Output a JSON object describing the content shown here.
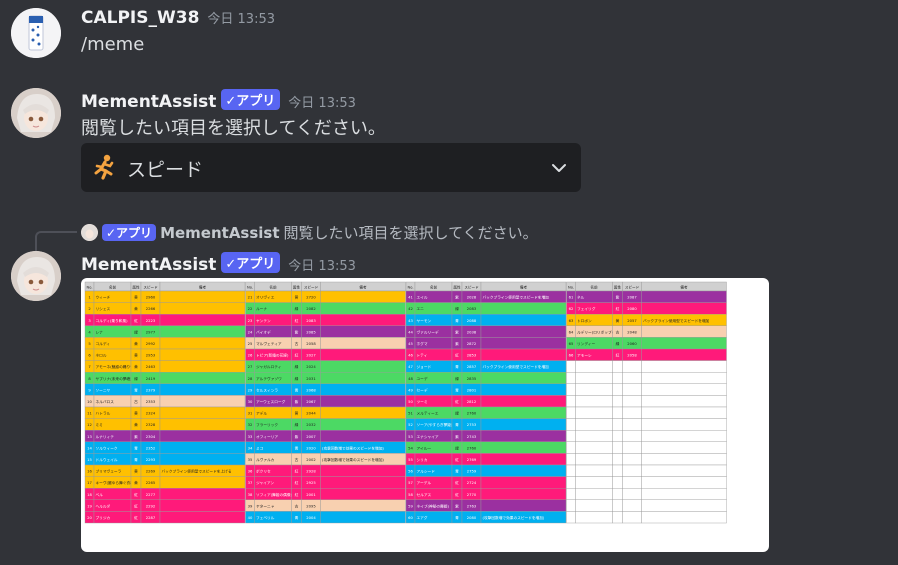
{
  "messages": [
    {
      "username": "CALPIS_W38",
      "time": "今日 13:53",
      "text": "/meme",
      "avatar_icon": "calpis-bottle-avatar"
    },
    {
      "username": "MementAssist",
      "badge": "✓アプリ",
      "time": "今日 13:53",
      "text": "閲覧したい項目を選択してください。",
      "avatar_icon": "anime-character-avatar",
      "select": {
        "emoji": "runner-emoji",
        "value": "スピード",
        "icon": "chevron-down-icon"
      }
    },
    {
      "reply": {
        "badge": "✓アプリ",
        "username": "MementAssist",
        "text": "閲覧したい項目を選択してください。"
      },
      "username": "MementAssist",
      "badge": "✓アプリ",
      "time": "今日 13:53",
      "attachment": "speed-table-image"
    }
  ],
  "table": {
    "header": [
      "No.",
      "名前",
      "属性",
      "スピード",
      "備考"
    ],
    "colors": {
      "yellow": "#ffc000",
      "green": "#4cd964",
      "red": "#ff1a7a",
      "purple": "#9b30a0",
      "blue": "#00b0f0",
      "peach": "#f8d0b0",
      "header": "#d0d0d0"
    },
    "columns": [
      {
        "rows": [
          {
            "no": "1",
            "name": "ウィーチ",
            "attr": "黄",
            "speed": "2960",
            "note": "",
            "color": "yellow"
          },
          {
            "no": "2",
            "name": "リシェス",
            "attr": "黄",
            "speed": "2266",
            "note": "",
            "color": "yellow"
          },
          {
            "no": "3",
            "name": "コルディ(乗り和風)",
            "attr": "紅",
            "speed": "2223",
            "note": "",
            "color": "red"
          },
          {
            "no": "4",
            "name": "レナ",
            "attr": "緑",
            "speed": "2977",
            "note": "",
            "color": "green"
          },
          {
            "no": "5",
            "name": "コルディ",
            "attr": "黄",
            "speed": "2992",
            "note": "",
            "color": "yellow"
          },
          {
            "no": "6",
            "name": "ネロル",
            "attr": "黄",
            "speed": "2953",
            "note": "",
            "color": "yellow"
          },
          {
            "no": "7",
            "name": "アモーネ(魅惑の踊り子)",
            "attr": "黄",
            "speed": "2463",
            "note": "",
            "color": "yellow"
          },
          {
            "no": "8",
            "name": "サブリナ(未来の夢峰)",
            "attr": "緑",
            "speed": "2419",
            "note": "",
            "color": "green"
          },
          {
            "no": "9",
            "name": "ソーニヤ",
            "attr": "青",
            "speed": "2379",
            "note": "",
            "color": "blue"
          },
          {
            "no": "10",
            "name": "ネルバロス",
            "attr": "古",
            "speed": "2353",
            "note": "",
            "color": "peach"
          },
          {
            "no": "11",
            "name": "ハトラル",
            "attr": "黄",
            "speed": "2324",
            "note": "",
            "color": "yellow"
          },
          {
            "no": "12",
            "name": "ミミ",
            "attr": "黄",
            "speed": "2328",
            "note": "",
            "color": "yellow"
          },
          {
            "no": "13",
            "name": "ルナリィテ",
            "attr": "紫",
            "speed": "2304",
            "note": "",
            "color": "purple"
          },
          {
            "no": "14",
            "name": "ソルウィーク",
            "attr": "青",
            "speed": "2352",
            "note": "",
            "color": "blue"
          },
          {
            "no": "15",
            "name": "ドルウェイル",
            "attr": "青",
            "speed": "2293",
            "note": "",
            "color": "blue"
          },
          {
            "no": "16",
            "name": "ブリマヴェーラ",
            "attr": "黄",
            "speed": "2269",
            "note": "バックプライン使用型でスピードを上げる",
            "color": "yellow"
          },
          {
            "no": "17",
            "name": "キーヴ(麗ゆら舞ぐ衣装)",
            "attr": "黄",
            "speed": "2265",
            "note": "",
            "color": "yellow"
          },
          {
            "no": "18",
            "name": "ベル",
            "attr": "紅",
            "speed": "2277",
            "note": "",
            "color": "red"
          },
          {
            "no": "19",
            "name": "ヘルルダ",
            "attr": "紅",
            "speed": "2292",
            "note": "",
            "color": "red"
          },
          {
            "no": "20",
            "name": "ブリジカ",
            "attr": "紅",
            "speed": "2287",
            "note": "",
            "color": "red"
          }
        ]
      },
      {
        "rows": [
          {
            "no": "21",
            "name": "オリヴィエ",
            "attr": "黄",
            "speed": "2720",
            "note": "",
            "color": "yellow"
          },
          {
            "no": "22",
            "name": "ルーナ",
            "attr": "緑",
            "speed": "2082",
            "note": "",
            "color": "green"
          },
          {
            "no": "23",
            "name": "ヤンテン",
            "attr": "紅",
            "speed": "2083",
            "note": "",
            "color": "red"
          },
          {
            "no": "24",
            "name": "バイオデ",
            "attr": "紫",
            "speed": "2085",
            "note": "",
            "color": "purple"
          },
          {
            "no": "25",
            "name": "マルヴェティア",
            "attr": "古",
            "speed": "2058",
            "note": "",
            "color": "peach"
          },
          {
            "no": "26",
            "name": "トピア(新婚の花嫁)",
            "attr": "紅",
            "speed": "2027",
            "note": "",
            "color": "red"
          },
          {
            "no": "27",
            "name": "ジャガルロティ",
            "attr": "緑",
            "speed": "2024",
            "note": "",
            "color": "green"
          },
          {
            "no": "28",
            "name": "アルテヴァゾワ",
            "attr": "緑",
            "speed": "2031",
            "note": "",
            "color": "green"
          },
          {
            "no": "29",
            "name": "セルスィンラ",
            "attr": "青",
            "speed": "2068",
            "note": "",
            "color": "blue"
          },
          {
            "no": "30",
            "name": "アーウェスローグ",
            "attr": "紫",
            "speed": "2067",
            "note": "",
            "color": "purple"
          },
          {
            "no": "31",
            "name": "アデル",
            "attr": "黄",
            "speed": "2044",
            "note": "",
            "color": "yellow"
          },
          {
            "no": "32",
            "name": "フラーリック",
            "attr": "緑",
            "speed": "2032",
            "note": "",
            "color": "green"
          },
          {
            "no": "33",
            "name": "オフィーリア",
            "attr": "紫",
            "speed": "2007",
            "note": "",
            "color": "purple"
          },
          {
            "no": "34",
            "name": "ミコ",
            "attr": "青",
            "speed": "2020",
            "note": "(攻撃回数増で効果のスピードを増加)",
            "color": "blue"
          },
          {
            "no": "35",
            "name": "ルヴァルカ",
            "attr": "古",
            "speed": "2002",
            "note": "(攻撃回数増で効果のスピードを増加)",
            "color": "peach"
          },
          {
            "no": "36",
            "name": "ボクリセ",
            "attr": "紅",
            "speed": "2928",
            "note": "",
            "color": "red"
          },
          {
            "no": "37",
            "name": "ジャイアン",
            "attr": "紅",
            "speed": "2925",
            "note": "",
            "color": "red"
          },
          {
            "no": "38",
            "name": "ソフィア(舞姫の偶像)",
            "attr": "紅",
            "speed": "2001",
            "note": "",
            "color": "red"
          },
          {
            "no": "39",
            "name": "ヤターニャ",
            "attr": "古",
            "speed": "2095",
            "note": "",
            "color": "peach"
          },
          {
            "no": "40",
            "name": "フェベリル",
            "attr": "青",
            "speed": "2004",
            "note": "",
            "color": "blue"
          }
        ]
      },
      {
        "rows": [
          {
            "no": "41",
            "name": "エイル",
            "attr": "紫",
            "speed": "2028",
            "note": "バックプライン使用型でスピードを増加",
            "color": "purple"
          },
          {
            "no": "42",
            "name": "エニ",
            "attr": "緑",
            "speed": "2083",
            "note": "",
            "color": "green"
          },
          {
            "no": "43",
            "name": "ヤーモン",
            "attr": "青",
            "speed": "2088",
            "note": "",
            "color": "blue"
          },
          {
            "no": "44",
            "name": "ヴァルリーデ",
            "attr": "紫",
            "speed": "2038",
            "note": "",
            "color": "purple"
          },
          {
            "no": "45",
            "name": "ホグマ",
            "attr": "紫",
            "speed": "2872",
            "note": "",
            "color": "purple"
          },
          {
            "no": "46",
            "name": "トティ",
            "attr": "紅",
            "speed": "2853",
            "note": "",
            "color": "red"
          },
          {
            "no": "47",
            "name": "ジョード",
            "attr": "青",
            "speed": "2857",
            "note": "バックプライン使用型でスピードを増加",
            "color": "blue"
          },
          {
            "no": "48",
            "name": "ユーデ",
            "attr": "緑",
            "speed": "2835",
            "note": "",
            "color": "green"
          },
          {
            "no": "49",
            "name": "セーデ",
            "attr": "青",
            "speed": "2801",
            "note": "",
            "color": "blue"
          },
          {
            "no": "50",
            "name": "ツーミ",
            "attr": "紅",
            "speed": "2812",
            "note": "",
            "color": "red"
          },
          {
            "no": "51",
            "name": "メルティーエ",
            "attr": "緑",
            "speed": "2760",
            "note": "",
            "color": "green"
          },
          {
            "no": "52",
            "name": "ソーア(やすらぎ夢姫)",
            "attr": "青",
            "speed": "2753",
            "note": "",
            "color": "blue"
          },
          {
            "no": "53",
            "name": "エナシャイア",
            "attr": "紫",
            "speed": "2743",
            "note": "",
            "color": "purple"
          },
          {
            "no": "54",
            "name": "アイル一",
            "attr": "緑",
            "speed": "2760",
            "note": "",
            "color": "green"
          },
          {
            "no": "55",
            "name": "シリカ",
            "attr": "紅",
            "speed": "2769",
            "note": "",
            "color": "red"
          },
          {
            "no": "56",
            "name": "アルシード",
            "attr": "青",
            "speed": "2759",
            "note": "",
            "color": "blue"
          },
          {
            "no": "57",
            "name": "アーデル",
            "attr": "紅",
            "speed": "2724",
            "note": "",
            "color": "red"
          },
          {
            "no": "58",
            "name": "セルアス",
            "attr": "紅",
            "speed": "2770",
            "note": "",
            "color": "red"
          },
          {
            "no": "59",
            "name": "ネイブ(神秘の舞姫)",
            "attr": "紫",
            "speed": "2763",
            "note": "",
            "color": "purple"
          },
          {
            "no": "60",
            "name": "エアグ",
            "attr": "青",
            "speed": "2080",
            "note": "(攻撃回数増で効果のスピードを増加)",
            "color": "blue"
          }
        ]
      },
      {
        "rows": [
          {
            "no": "61",
            "name": "ネル",
            "attr": "紫",
            "speed": "2087",
            "note": "",
            "color": "purple"
          },
          {
            "no": "62",
            "name": "フェイリグ",
            "attr": "紅",
            "speed": "2080",
            "note": "",
            "color": "red"
          },
          {
            "no": "63",
            "name": "トロポン",
            "attr": "黄",
            "speed": "2057",
            "note": "バックプライン使用型でスピードを増加",
            "color": "yellow"
          },
          {
            "no": "64",
            "name": "ルデリー(ロリポップの相棒)",
            "attr": "古",
            "speed": "2048",
            "note": "",
            "color": "peach"
          },
          {
            "no": "65",
            "name": "リンディー",
            "attr": "緑",
            "speed": "2060",
            "note": "",
            "color": "green"
          },
          {
            "no": "66",
            "name": "アモーレ",
            "attr": "紅",
            "speed": "2058",
            "note": "",
            "color": "red"
          }
        ]
      }
    ]
  }
}
